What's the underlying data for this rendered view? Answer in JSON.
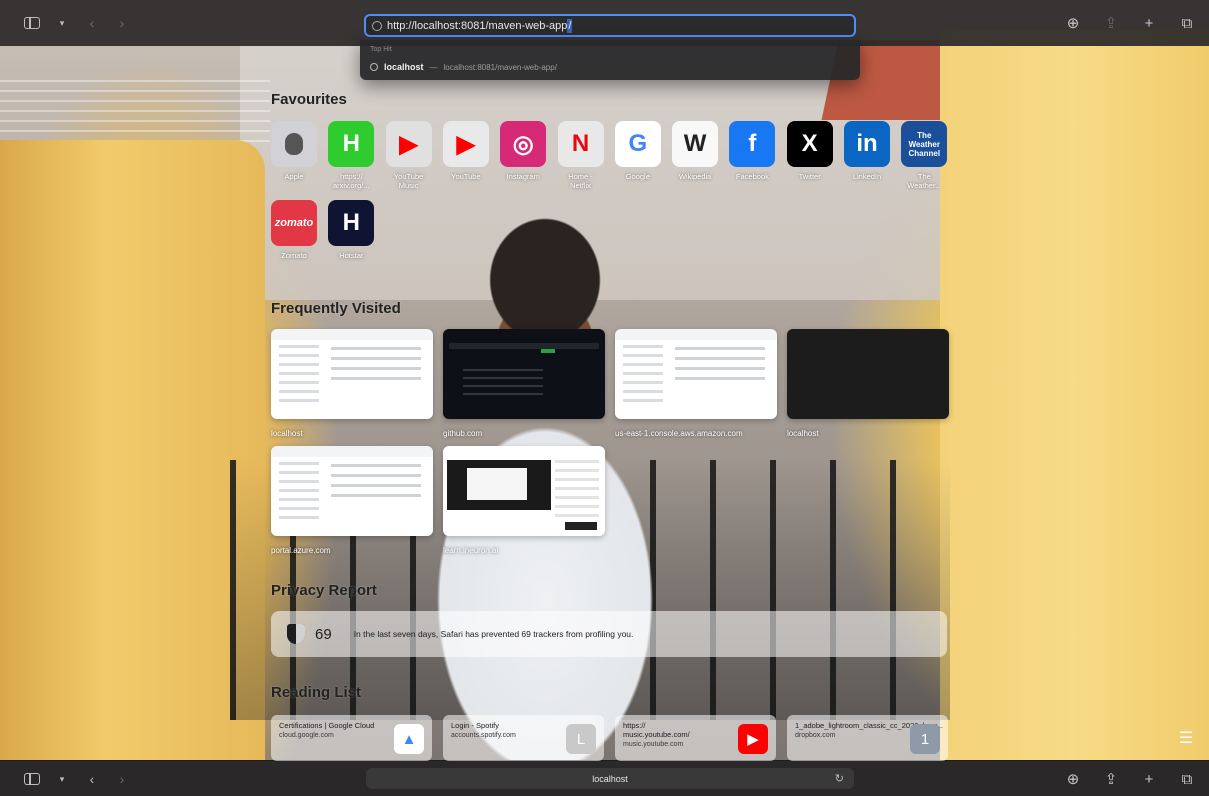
{
  "toolbar": {
    "address_value": "http://localhost:8081/maven-web-app/",
    "address_typed": "http://localhost:8081/maven-web-app",
    "address_selected": "/",
    "icons": [
      "sidebar-icon",
      "chevron-down-icon",
      "back-icon",
      "forward-icon",
      "download-icon",
      "share-icon",
      "new-tab-icon",
      "tab-overview-icon"
    ]
  },
  "dropdown": {
    "header": "Top Hit",
    "item_title": "localhost",
    "item_separator": "—",
    "item_url": "localhost:8081/maven-web-app/"
  },
  "favourites": {
    "title": "Favourites",
    "items": [
      {
        "label": "Apple",
        "bg": "#d1d1d6",
        "glyph": "",
        "color": "#555"
      },
      {
        "label": "https://\narxiv.org/...",
        "bg": "#2ecc2e",
        "glyph": "H",
        "color": "#ffffff"
      },
      {
        "label": "YouTube\nMusic",
        "bg": "#e0e0e0",
        "glyph": "▶",
        "color": "#ff0000"
      },
      {
        "label": "YouTube",
        "bg": "#e9e9ea",
        "glyph": "▶",
        "color": "#ff0000"
      },
      {
        "label": "Instagram",
        "bg": "#d62976",
        "glyph": "◎",
        "color": "#ffffff"
      },
      {
        "label": "Home -\nNetflix",
        "bg": "#e8e8e8",
        "glyph": "N",
        "color": "#e50914"
      },
      {
        "label": "Google",
        "bg": "#ffffff",
        "glyph": "G",
        "color": "#4285f4"
      },
      {
        "label": "Wikipedia",
        "bg": "#f8f8f8",
        "glyph": "W",
        "color": "#222222"
      },
      {
        "label": "Facebook",
        "bg": "#1877f2",
        "glyph": "f",
        "color": "#ffffff"
      },
      {
        "label": "Twitter",
        "bg": "#000000",
        "glyph": "X",
        "color": "#ffffff"
      },
      {
        "label": "LinkedIn",
        "bg": "#0a66c2",
        "glyph": "in",
        "color": "#ffffff"
      },
      {
        "label": "The\nWeather...",
        "bg": "#1b4f9c",
        "glyph": "The\nWeather\nChannel",
        "color": "#ffffff"
      },
      {
        "label": "Zomato",
        "bg": "#e23744",
        "glyph": "zomato",
        "color": "#ffffff"
      },
      {
        "label": "Hotstar",
        "bg": "#0f1433",
        "glyph": "H",
        "color": "#ffffff"
      }
    ]
  },
  "frequently_visited": {
    "title": "Frequently Visited",
    "items": [
      {
        "label": "localhost",
        "theme": "light"
      },
      {
        "label": "github.com",
        "theme": "dark"
      },
      {
        "label": "us-east-1.console.aws.amazon.com",
        "theme": "light"
      },
      {
        "label": "localhost",
        "theme": "black"
      },
      {
        "label": "portal.azure.com",
        "theme": "light"
      },
      {
        "label": "learn.ineuron.ai",
        "theme": "video"
      }
    ]
  },
  "privacy": {
    "title": "Privacy Report",
    "count": "69",
    "message": "In the last seven days, Safari has prevented 69 trackers from profiling you."
  },
  "reading_list": {
    "title": "Reading List",
    "items": [
      {
        "title": "Certifications | Google Cloud",
        "url": "cloud.google.com",
        "thumb": "▲",
        "thumb_bg": "#ffffff",
        "thumb_color": "#4285f4"
      },
      {
        "title": "Login - Spotify",
        "url": "accounts.spotify.com",
        "thumb": "L",
        "thumb_bg": "#c9c9c9",
        "thumb_color": "#ffffff"
      },
      {
        "title": "https://\nmusic.youtube.com/",
        "url": "music.youtube.com",
        "thumb": "▶",
        "thumb_bg": "#ff0000",
        "thumb_color": "#ffffff"
      },
      {
        "title": "1_adobe_lightroom_classic_cc_2020_k_pr...",
        "url": "dropbox.com",
        "thumb": "1",
        "thumb_bg": "#8e9aa8",
        "thumb_color": "#ffffff"
      }
    ]
  },
  "bottombar": {
    "address": "localhost"
  }
}
